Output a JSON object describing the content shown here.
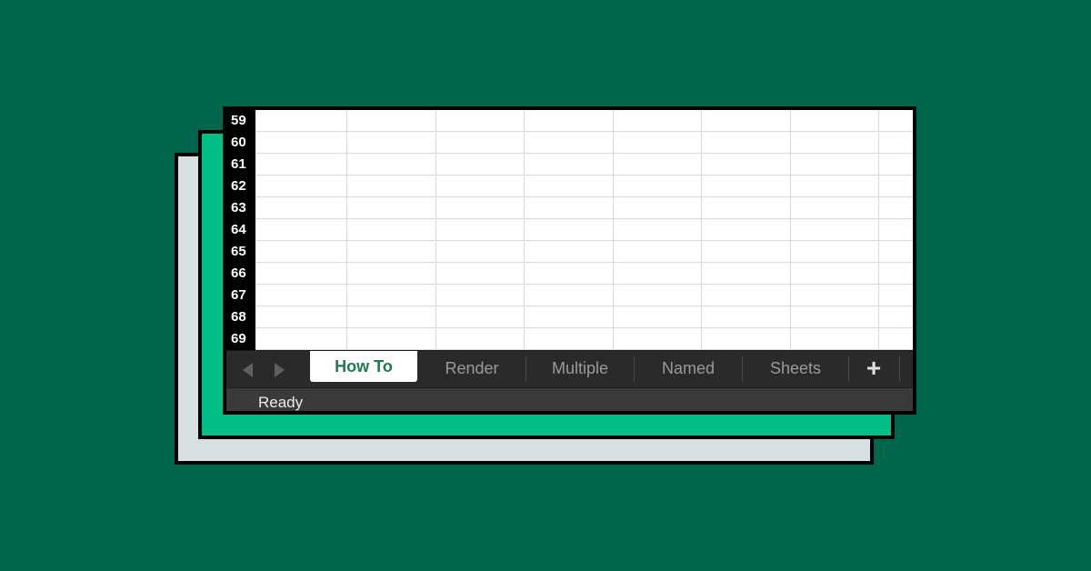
{
  "rows": [
    "59",
    "60",
    "61",
    "62",
    "63",
    "64",
    "65",
    "66",
    "67",
    "68",
    "69"
  ],
  "tabs": [
    {
      "label": "How To",
      "active": true
    },
    {
      "label": "Render",
      "active": false
    },
    {
      "label": "Multiple",
      "active": false
    },
    {
      "label": "Named",
      "active": false
    },
    {
      "label": "Sheets",
      "active": false
    }
  ],
  "add_tab_label": "+",
  "status": "Ready",
  "colors": {
    "background": "#00654d",
    "green_card": "#00bf86",
    "grey_card": "#d8dfe0",
    "active_tab_text": "#1c7a4d"
  },
  "icons": {
    "prev": "triangle-left",
    "next": "triangle-right"
  }
}
